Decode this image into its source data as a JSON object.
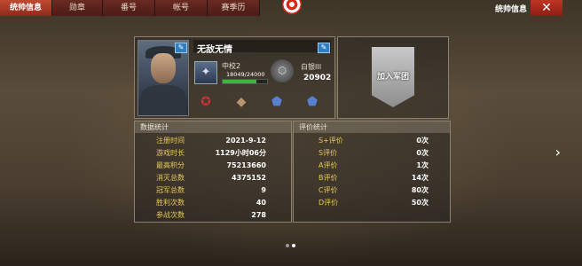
{
  "tabs": [
    "统帅信息",
    "勋章",
    "番号",
    "帐号",
    "赛季历"
  ],
  "header": {
    "right_title": "统帅信息",
    "close": "✕"
  },
  "profile": {
    "name": "无敌无情",
    "rank_title": "中校2",
    "exp_text": "18049/24000",
    "exp_fraction": 0.752,
    "tier_name": "白银III",
    "tier_score": "20902"
  },
  "legion": {
    "button_label": "加入军团"
  },
  "stats": {
    "title": "数据统计",
    "rows": [
      {
        "label": "注册时间",
        "value": "2021-9-12"
      },
      {
        "label": "游戏时长",
        "value": "1129小时06分"
      },
      {
        "label": "最高积分",
        "value": "75213660"
      },
      {
        "label": "消灭总数",
        "value": "4375152"
      },
      {
        "label": "冠军总数",
        "value": "9"
      },
      {
        "label": "胜利次数",
        "value": "40"
      },
      {
        "label": "参战次数",
        "value": "278"
      }
    ]
  },
  "ratings": {
    "title": "评价统计",
    "rows": [
      {
        "label": "S+评价",
        "value": "0次"
      },
      {
        "label": "S评价",
        "value": "0次"
      },
      {
        "label": "A评价",
        "value": "1次"
      },
      {
        "label": "B评价",
        "value": "14次"
      },
      {
        "label": "C评价",
        "value": "80次"
      },
      {
        "label": "D评价",
        "value": "50次"
      }
    ]
  },
  "nav": {
    "next_arrow": "›"
  },
  "colors": {
    "accent": "#c04a30",
    "label": "#e8c95a",
    "exp": "#39b83a"
  }
}
